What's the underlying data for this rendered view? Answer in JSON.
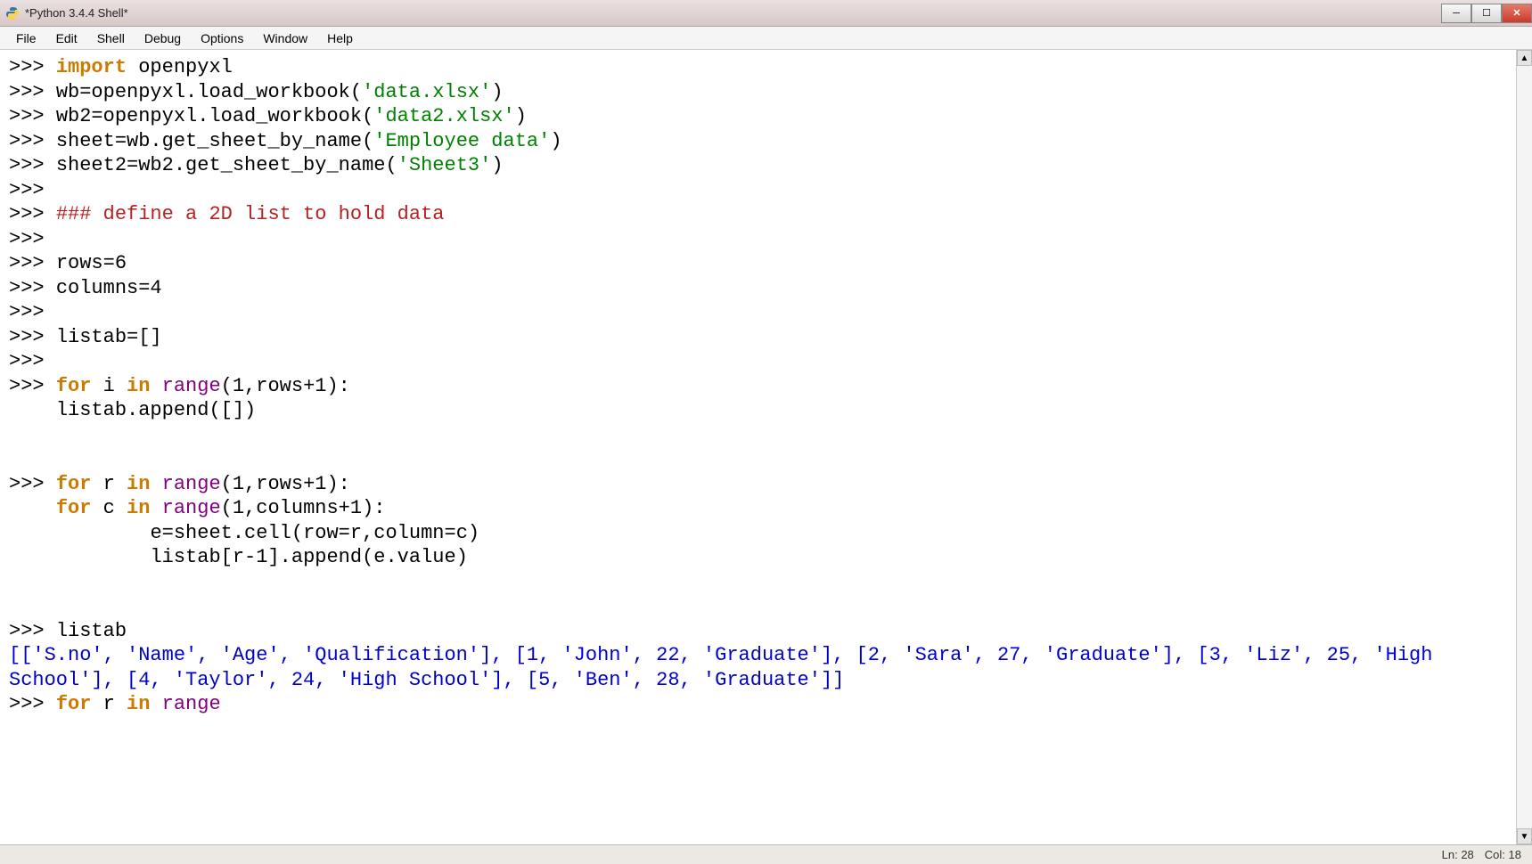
{
  "title": "*Python 3.4.4 Shell*",
  "menus": {
    "file": "File",
    "edit": "Edit",
    "shell": "Shell",
    "debug": "Debug",
    "options": "Options",
    "window": "Window",
    "help": "Help"
  },
  "prompt": ">>> ",
  "tokens": {
    "import": "import",
    "openpyxl": "openpyxl",
    "for": "for",
    "in": "in",
    "range": "range"
  },
  "code": {
    "l1_a": "import",
    "l1_b": " openpyxl",
    "l2_a": "wb=openpyxl.load_workbook(",
    "l2_b": "'data.xlsx'",
    "l2_c": ")",
    "l3_a": "wb2=openpyxl.load_workbook(",
    "l3_b": "'data2.xlsx'",
    "l3_c": ")",
    "l4_a": "sheet=wb.get_sheet_by_name(",
    "l4_b": "'Employee data'",
    "l4_c": ")",
    "l5_a": "sheet2=wb2.get_sheet_by_name(",
    "l5_b": "'Sheet3'",
    "l5_c": ")",
    "l6_comment": "### define a 2D list to hold data",
    "l7": "rows=6",
    "l8": "columns=4",
    "l9": "listab=[]",
    "l10_a": "for",
    "l10_b": " i ",
    "l10_c": "in",
    "l10_d": " ",
    "l10_e": "range",
    "l10_f": "(1,rows+1):",
    "l10_body": "    listab.append([])",
    "l11_a": "for",
    "l11_b": " r ",
    "l11_c": "in",
    "l11_d": " ",
    "l11_e": "range",
    "l11_f": "(1,rows+1):",
    "l11_body1_a": "    ",
    "l11_body1_for": "for",
    "l11_body1_b": " c ",
    "l11_body1_in": "in",
    "l11_body1_c": " ",
    "l11_body1_range": "range",
    "l11_body1_d": "(1,columns+1):",
    "l11_body2": "            e=sheet.cell(row=r,column=c)",
    "l11_body3": "            listab[r-1].append(e.value)",
    "l12": "listab",
    "output": "[['S.no', 'Name', 'Age', 'Qualification'], [1, 'John', 22, 'Graduate'], [2, 'Sara', 27, 'Graduate'], [3, 'Liz', 25, 'High School'], [4, 'Taylor', 24, 'High School'], [5, 'Ben', 28, 'Graduate']]",
    "l13_a": "for",
    "l13_b": " r ",
    "l13_c": "in",
    "l13_d": " ",
    "l13_e": "range"
  },
  "status": {
    "ln": "Ln: 28",
    "col": "Col: 18"
  }
}
